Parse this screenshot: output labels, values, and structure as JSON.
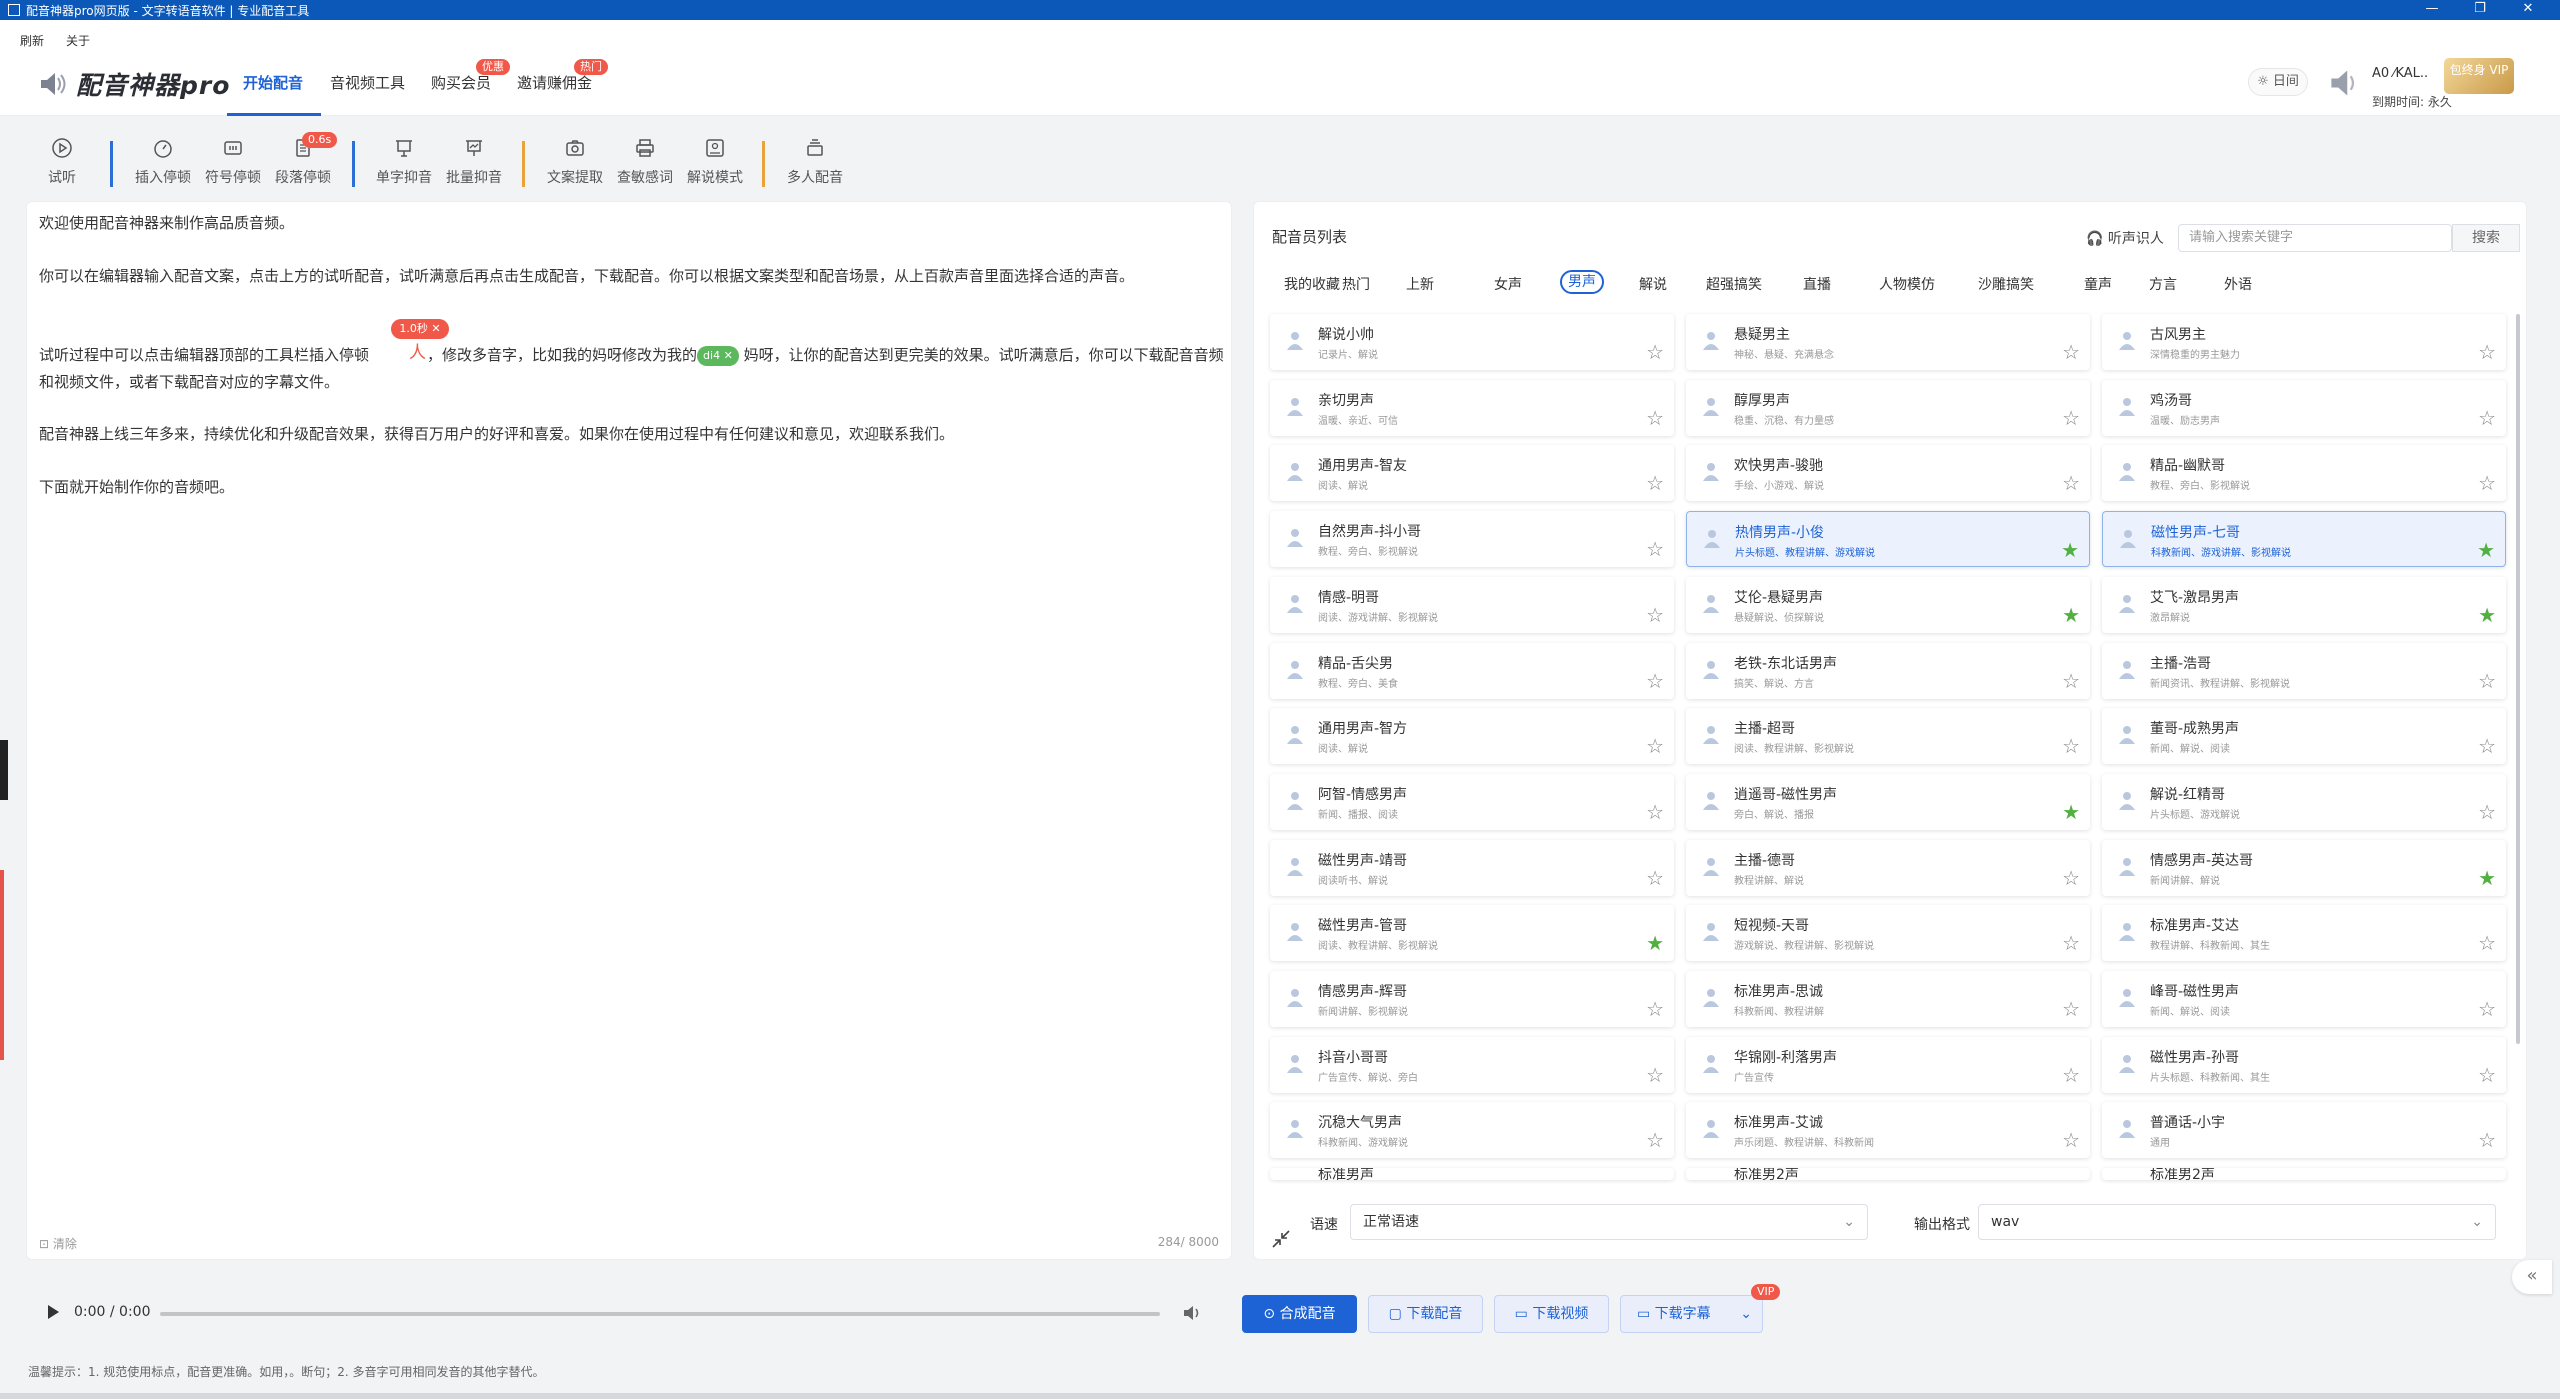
{
  "window": {
    "title": "配音神器pro网页版 - 文字转语音软件 | 专业配音工具",
    "controls": [
      "—",
      "❐",
      "✕"
    ]
  },
  "menu": {
    "refresh": "刷新",
    "about": "关于"
  },
  "header": {
    "logo": "配音神器pro",
    "nav": [
      {
        "label": "开始配音",
        "badge": ""
      },
      {
        "label": "音视频工具",
        "badge": ""
      },
      {
        "label": "购买会员",
        "badge": "优惠"
      },
      {
        "label": "邀请赚佣金",
        "badge": "热门"
      }
    ],
    "theme": "☼ 日间",
    "user": "A0 ⁄KAL..",
    "vip": "包终身 VIP",
    "expire": "到期时间: 永久"
  },
  "toolbar": {
    "preview": "试听",
    "insert_pause": "插入停顿",
    "symbol_pause": "符号停顿",
    "para_pause": "段落停顿",
    "para_badge": "0.6s",
    "single_tone": "单字抑音",
    "batch_tone": "批量抑音",
    "extract": "文案提取",
    "sensitive": "查敏感词",
    "explain": "解说模式",
    "multi": "多人配音"
  },
  "editor": {
    "p1": "欢迎使用配音神器来制作高品质音频。",
    "p2": "你可以在编辑器输入配音文案，点击上方的试听配音，试听满意后再点击生成配音，下载配音。你可以根据文案类型和配音场景，从上百款声音里面选择合适的声音。",
    "p3a": "试听过程中可以点击编辑器顶部的工具栏插入停顿",
    "p3b": "，修改多音字，比如我的妈呀修改为我的",
    "p3c": "妈呀，让你的配音达到更完美的效果。试听满意后，你可以下载配音音频和视频文件，或者下载配音对应的字幕文件。",
    "pause_tag": "1.0秒 ✕",
    "pause_mark": "人",
    "poly_tag": "di4 ✕",
    "p4": "配音神器上线三年多来，持续优化和升级配音效果，获得百万用户的好评和喜爱。如果你在使用过程中有任何建议和意见，欢迎联系我们。",
    "p5": "下面就开始制作你的音频吧。",
    "clear": "⊡ 清除",
    "count": "284/ 8000"
  },
  "voices": {
    "title": "配音员列表",
    "identify": "🎧 听声识人",
    "search_placeholder": "请输入搜索关键字",
    "search_btn": "搜索",
    "categories": [
      "我的收藏",
      "热门",
      "上新",
      "女声",
      "男声",
      "解说",
      "超强搞笑",
      "直播",
      "人物模仿",
      "沙雕搞笑",
      "童声",
      "方言",
      "外语"
    ],
    "active_category": "男声",
    "cards": [
      {
        "name": "解说小帅",
        "tags": "记录片、解说",
        "fav": false,
        "sel": false
      },
      {
        "name": "悬疑男主",
        "tags": "神秘、悬疑、充满悬念",
        "fav": false,
        "sel": false
      },
      {
        "name": "古风男主",
        "tags": "深情稳重的男主魅力",
        "fav": false,
        "sel": false
      },
      {
        "name": "亲切男声",
        "tags": "温暖、亲近、可信",
        "fav": false,
        "sel": false
      },
      {
        "name": "醇厚男声",
        "tags": "稳重、沉稳、有力量感",
        "fav": false,
        "sel": false
      },
      {
        "name": "鸡汤哥",
        "tags": "温暖、励志男声",
        "fav": false,
        "sel": false
      },
      {
        "name": "通用男声-智友",
        "tags": "阅读、解说",
        "fav": false,
        "sel": false
      },
      {
        "name": "欢快男声-骏驰",
        "tags": "手绘、小游戏、解说",
        "fav": false,
        "sel": false
      },
      {
        "name": "精品-幽默哥",
        "tags": "教程、旁白、影视解说",
        "fav": false,
        "sel": false
      },
      {
        "name": "自然男声-抖小哥",
        "tags": "教程、旁白、影视解说",
        "fav": false,
        "sel": false
      },
      {
        "name": "热情男声-小俊",
        "tags": "片头标题、教程讲解、游戏解说",
        "fav": true,
        "sel": true
      },
      {
        "name": "磁性男声-七哥",
        "tags": "科教新闻、游戏讲解、影视解说",
        "fav": true,
        "sel": true
      },
      {
        "name": "情感-明哥",
        "tags": "阅读、游戏讲解、影视解说",
        "fav": false,
        "sel": false
      },
      {
        "name": "艾伦-悬疑男声",
        "tags": "悬疑解说、侦探解说",
        "fav": true,
        "sel": false
      },
      {
        "name": "艾飞-激昂男声",
        "tags": "激昂解说",
        "fav": true,
        "sel": false
      },
      {
        "name": "精品-舌尖男",
        "tags": "教程、旁白、美食",
        "fav": false,
        "sel": false
      },
      {
        "name": "老铁-东北话男声",
        "tags": "搞笑、解说、方言",
        "fav": false,
        "sel": false
      },
      {
        "name": "主播-浩哥",
        "tags": "新闻资讯、教程讲解、影视解说",
        "fav": false,
        "sel": false
      },
      {
        "name": "通用男声-智方",
        "tags": "阅读、解说",
        "fav": false,
        "sel": false
      },
      {
        "name": "主播-超哥",
        "tags": "阅读、教程讲解、影视解说",
        "fav": false,
        "sel": false
      },
      {
        "name": "董哥-成熟男声",
        "tags": "新闻、解说、阅读",
        "fav": false,
        "sel": false
      },
      {
        "name": "阿智-情感男声",
        "tags": "新闻、播报、阅读",
        "fav": false,
        "sel": false
      },
      {
        "name": "逍遥哥-磁性男声",
        "tags": "旁白、解说、播报",
        "fav": true,
        "sel": false
      },
      {
        "name": "解说-红精哥",
        "tags": "片头标题、游戏解说",
        "fav": false,
        "sel": false
      },
      {
        "name": "磁性男声-靖哥",
        "tags": "阅读听书、解说",
        "fav": false,
        "sel": false
      },
      {
        "name": "主播-德哥",
        "tags": "教程讲解、解说",
        "fav": false,
        "sel": false
      },
      {
        "name": "情感男声-英达哥",
        "tags": "新闻讲解、解说",
        "fav": true,
        "sel": false
      },
      {
        "name": "磁性男声-管哥",
        "tags": "阅读、教程讲解、影视解说",
        "fav": true,
        "sel": false
      },
      {
        "name": "短视频-天哥",
        "tags": "游戏解说、教程讲解、影视解说",
        "fav": false,
        "sel": false
      },
      {
        "name": "标准男声-艾达",
        "tags": "教程讲解、科教新闻、其生",
        "fav": false,
        "sel": false
      },
      {
        "name": "情感男声-辉哥",
        "tags": "新闻讲解、影视解说",
        "fav": false,
        "sel": false
      },
      {
        "name": "标准男声-思诚",
        "tags": "科教新闻、教程讲解",
        "fav": false,
        "sel": false
      },
      {
        "name": "峰哥-磁性男声",
        "tags": "新闻、解说、阅读",
        "fav": false,
        "sel": false
      },
      {
        "name": "抖音小哥哥",
        "tags": "广告宣传、解说、旁白",
        "fav": false,
        "sel": false
      },
      {
        "name": "华锦刚-利落男声",
        "tags": "广告宣传",
        "fav": false,
        "sel": false
      },
      {
        "name": "磁性男声-孙哥",
        "tags": "片头标题、科教新闻、其生",
        "fav": false,
        "sel": false
      },
      {
        "name": "沉稳大气男声",
        "tags": "科教新闻、游戏解说",
        "fav": false,
        "sel": false
      },
      {
        "name": "标准男声-艾诚",
        "tags": "声乐闭题、教程讲解、科教新闻",
        "fav": false,
        "sel": false
      },
      {
        "name": "普通话-小宇",
        "tags": "通用",
        "fav": false,
        "sel": false
      }
    ],
    "partial": [
      "标准男声",
      "标准男2声",
      "标准男2声"
    ],
    "speed_label": "语速",
    "speed_value": "正常语速",
    "format_label": "输出格式",
    "format_value": "wav"
  },
  "player": {
    "time": "0:00 / 0:00"
  },
  "actions": {
    "synth": "⊙ 合成配音",
    "dl_audio": "▢ 下载配音",
    "dl_video": "▭ 下载视频",
    "dl_sub": "▭ 下载字幕",
    "vip": "VIP"
  },
  "tip": "温馨提示：1. 规范使用标点，配音更准确。如用，。断句；2. 多音字可用相同发音的其他字替代。",
  "colors": {
    "accent": "#1e63d6",
    "badge": "#f0594a",
    "fav_star": "#52b043",
    "titlebar": "#0b58b8"
  }
}
